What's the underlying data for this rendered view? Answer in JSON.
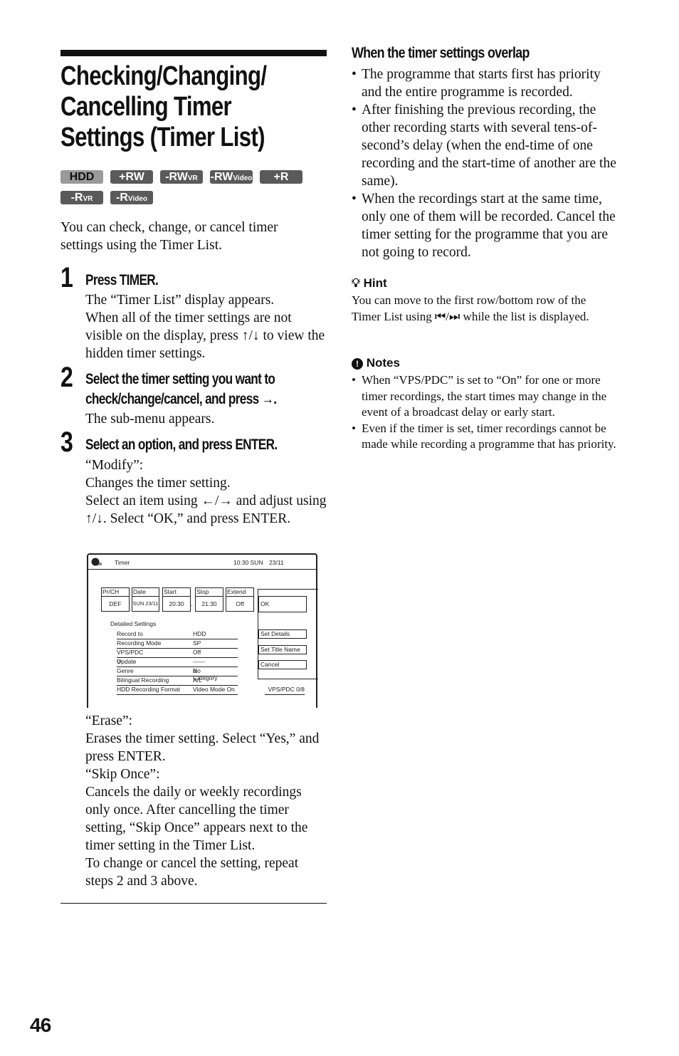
{
  "title_lines": [
    "Checking/Changing/",
    "Cancelling Timer",
    "Settings (Timer List)"
  ],
  "badges": [
    {
      "label": "HDD",
      "sub": "",
      "color": "#9a9a9a"
    },
    {
      "label": "+RW",
      "sub": ""
    },
    {
      "label": "-RW",
      "sub": "VR"
    },
    {
      "label": "-RW",
      "sub": "Video"
    },
    {
      "label": "+R",
      "sub": ""
    },
    {
      "label": "-R",
      "sub": "VR"
    },
    {
      "label": "-R",
      "sub": "Video"
    }
  ],
  "intro": "You can check, change, or cancel timer settings using the Timer List.",
  "steps": [
    {
      "num": "1",
      "head": "Press TIMER.",
      "body": [
        "The “Timer List” display appears.",
        "When all of the timer settings are not visible on the display, press ↑/↓ to view the hidden timer settings."
      ]
    },
    {
      "num": "2",
      "head": "Select the timer setting you want to check/change/cancel, and press →.",
      "body": [
        "The sub-menu appears."
      ]
    },
    {
      "num": "3",
      "head": "Select an option, and press ENTER.",
      "body": [
        "“Modify”:",
        "Changes the timer setting.",
        "Select an item using ←/→ and adjust using ↑/↓. Select “OK,” and press ENTER."
      ]
    }
  ],
  "after_screen": [
    "“Erase”:",
    "Erases the timer setting. Select “Yes,” and press ENTER.",
    "“Skip Once”:",
    "Cancels the daily or weekly recordings only once. After cancelling the timer setting, “Skip Once” appears next to the timer setting in the Timer List.",
    "To change or cancel the setting, repeat steps 2 and 3 above."
  ],
  "screen": {
    "title": "Timer",
    "clock": "10:30 SUN",
    "date": "23/11",
    "fields": [
      {
        "label": "Pr/CH",
        "value": "DEF"
      },
      {
        "label": "Date",
        "value": "SUN 23/11"
      },
      {
        "label": "Start",
        "value": "20:30"
      },
      {
        "label": "Stop",
        "value": "21:30"
      },
      {
        "label": "Extend",
        "value": "Off"
      }
    ],
    "dash": "-",
    "detailed_label": "Detailed Settings",
    "rows": [
      {
        "k": "Record to",
        "v": "HDD"
      },
      {
        "k": "Recording Mode",
        "v": "SP"
      },
      {
        "k": "VPS/PDC",
        "v": "Off"
      },
      {
        "k": "Update",
        "v": "------"
      },
      {
        "k": "Genre",
        "v": "No Category"
      },
      {
        "k": "Bilingual Recording",
        "v": "A/L"
      },
      {
        "k": "HDD Recording Format",
        "v": "Video Mode On"
      }
    ],
    "menu": [
      "OK",
      "Set Details",
      "Set Title Name",
      "Cancel"
    ],
    "vps": "VPS/PDC 0/8"
  },
  "overlap": {
    "heading": "When the timer settings overlap",
    "items": [
      "The programme that starts first has priority and the entire programme is recorded.",
      "After finishing the previous recording, the other recording starts with several tens-of-second’s delay (when the end-time of one recording and the start-time of another are the same).",
      "When the recordings start at the same time, only one of them will be recorded. Cancel the timer setting for the programme that you are not going to record."
    ]
  },
  "hint": {
    "heading": "Hint",
    "text": "You can move to the first row/bottom row of the Timer List using ⏮/⏭ while the list is displayed."
  },
  "notes": {
    "heading": "Notes",
    "items": [
      "When “VPS/PDC” is set to “On” for one or more timer recordings, the start times may change in the event of a broadcast delay or early start.",
      "Even if the timer is set, timer recordings cannot be made while recording a programme that has priority."
    ]
  },
  "page_number": "46"
}
